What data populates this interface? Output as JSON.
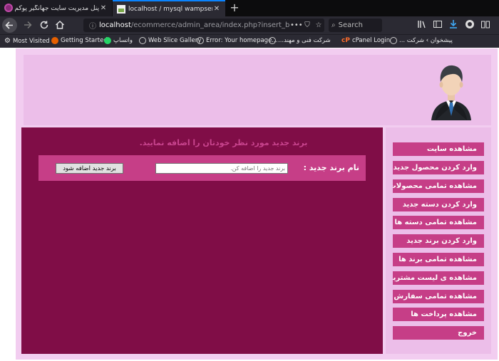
{
  "browser": {
    "tabs": [
      {
        "title": "پنل مدیریت سایت جهانگیر پوکم",
        "active": false
      },
      {
        "title": "localhost / mysql wampserver / ec",
        "active": true
      }
    ],
    "url": {
      "host": "localhost",
      "path": "/ecommerce/admin_area/index.php?insert_bran"
    },
    "search_placeholder": "Search",
    "bookmarks": [
      "Most Visited",
      "Getting Started",
      "واتساپ",
      "Web Slice Gallery",
      "Error: Your homepage...",
      "شرکت فنی و مهند...",
      "cPanel Login",
      "پیشخوان › شرکت ..."
    ]
  },
  "admin": {
    "heading": "برند جدید مورد نظر خودتان را اضافه نمایید.",
    "form": {
      "label": "نام برند جدید :",
      "input_placeholder": "برند جدید را اضافه کن.",
      "input_value": "",
      "submit_label": "برند جدید اضافه شود"
    },
    "menu": [
      "مشاهده سایت",
      "وارد کردن محصول جدید",
      "مشاهده تمامی محصولات",
      "وارد کردن دسته جدید",
      "مشاهده تمامی دسته ها",
      "وارد کردن برند جدید",
      "مشاهده تمامی برند ها",
      "مشاهده ی لیست مشتریان",
      "مشاهده تمامی سفارش ها",
      "مشاهده پرداخت ها",
      "خروج"
    ]
  },
  "colors": {
    "content_bg": "#800d47",
    "accent": "#c63e87",
    "header_bg": "#ecbee9",
    "wrapper_bg": "#f2cdf0",
    "heading_text": "#c8448e"
  },
  "icons": {
    "avatar": "businessman-avatar-icon"
  }
}
